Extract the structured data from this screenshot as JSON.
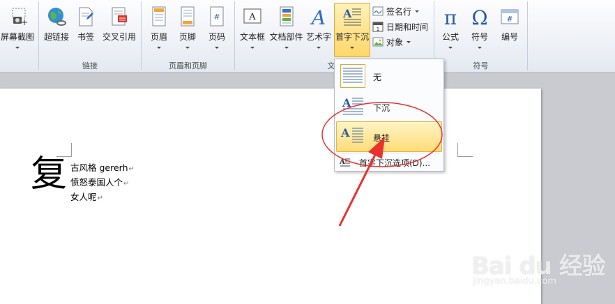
{
  "ribbon": {
    "buttons": {
      "screenshot": "屏幕截图",
      "hyperlink": "超链接",
      "bookmark": "书签",
      "cross_reference": "交叉引用",
      "header": "页眉",
      "footer": "页脚",
      "page_number": "页码",
      "text_box": "文本框",
      "quick_parts": "文档部件",
      "wordart": "艺术字",
      "drop_cap": "首字下沉",
      "equation": "公式",
      "symbol": "符号",
      "numbering": "编号"
    },
    "small_buttons": {
      "signature_line": "签名行",
      "date_time": "日期和时间",
      "object": "对象"
    },
    "groups": {
      "links": "链接",
      "header_footer": "页眉和页脚",
      "text_partial": "文",
      "symbols": "符号"
    }
  },
  "dropdown": {
    "items": [
      {
        "label": "无"
      },
      {
        "label": "下沉"
      },
      {
        "label": "悬挂"
      }
    ],
    "options_label": "首字下沉选项(D)...",
    "highlighted_index": 2
  },
  "document": {
    "drop_cap_char": "复",
    "lines": [
      "古风格 gererh",
      "愤怒泰国人个",
      "女人呢"
    ],
    "paragraph_mark": "↵"
  },
  "watermark": {
    "brand": "Bai du 经验",
    "url": "jingyan.baidu.com"
  },
  "colors": {
    "ribbon_bg": "#eef1f6",
    "active_button": "#ffd76a",
    "annotation_red": "#e8322d",
    "doc_bg": "#c9cbd0"
  }
}
